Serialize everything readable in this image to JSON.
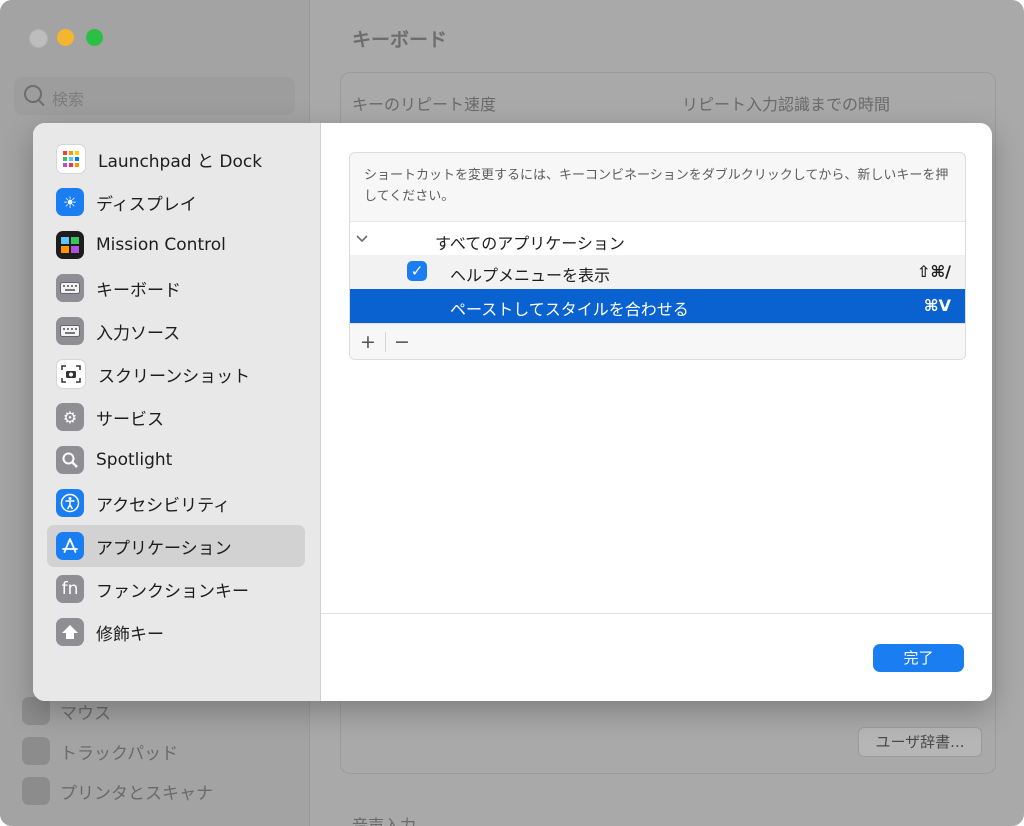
{
  "background": {
    "search_placeholder": "検索",
    "main_title": "キーボード",
    "key_repeat_label": "キーのリピート速度",
    "repeat_delay_label": "リピート入力認識までの時間",
    "user_dictionary_button": "ユーザ辞書...",
    "bottom_section_label": "音声入力",
    "sidebar_items": [
      "マウス",
      "トラックパッド",
      "プリンタとスキャナ"
    ]
  },
  "sidebar": {
    "items": [
      {
        "label": "Launchpad と Dock",
        "icon": "launchpad-icon",
        "color": "#ffffff"
      },
      {
        "label": "ディスプレイ",
        "icon": "display-icon",
        "color": "#1a7ef2"
      },
      {
        "label": "Mission Control",
        "icon": "mission-control-icon",
        "color": "#1d1d1f"
      },
      {
        "label": "キーボード",
        "icon": "keyboard-icon",
        "color": "#8e8e93"
      },
      {
        "label": "入力ソース",
        "icon": "input-source-icon",
        "color": "#8e8e93"
      },
      {
        "label": "スクリーンショット",
        "icon": "screenshot-icon",
        "color": "#ffffff"
      },
      {
        "label": "サービス",
        "icon": "gears-icon",
        "color": "#8e8e93"
      },
      {
        "label": "Spotlight",
        "icon": "magnifier-icon",
        "color": "#8e8e93"
      },
      {
        "label": "アクセシビリティ",
        "icon": "accessibility-icon",
        "color": "#1a7ef2"
      },
      {
        "label": "アプリケーション",
        "icon": "app-store-icon",
        "color": "#1a7ef2",
        "selected": true
      },
      {
        "label": "ファンクションキー",
        "icon": "fn-key-icon",
        "color": "#8e8e93"
      },
      {
        "label": "修飾キー",
        "icon": "modifier-key-icon",
        "color": "#8e8e93"
      }
    ]
  },
  "content": {
    "instruction": "ショートカットを変更するには、キーコンビネーションをダブルクリックしてから、新しいキーを押してください。",
    "group_label": "すべてのアプリケーション",
    "rows": [
      {
        "label": "ヘルプメニューを表示",
        "shortcut": "⇧⌘/",
        "checked": true
      },
      {
        "label": "ペーストしてスタイルを合わせる",
        "shortcut": "⌘V",
        "selected": true
      }
    ],
    "add_button": "+",
    "remove_button": "−",
    "done_button": "完了",
    "accent_color": "#1a7ef2",
    "selection_color": "#0a62d0"
  }
}
